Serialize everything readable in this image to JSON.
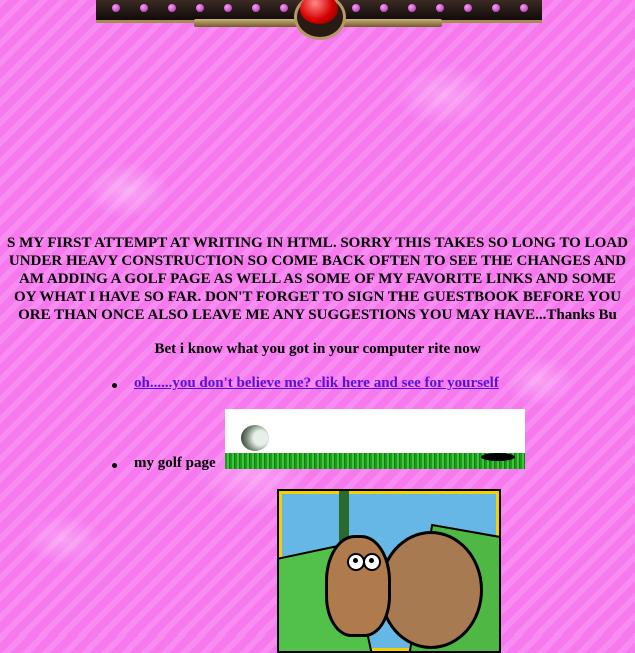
{
  "banner": {
    "colors": {
      "bar": "#120a08",
      "accent": "#b49a62",
      "ball": "#d60000"
    }
  },
  "intro": {
    "lines": [
      "S MY FIRST ATTEMPT AT WRITING IN HTML. SORRY THIS TAKES SO LONG TO LOAD",
      "UNDER HEAVY CONSTRUCTION SO COME BACK OFTEN TO SEE THE CHANGES AND",
      "AM ADDING A GOLF PAGE AS WELL AS SOME OF MY FAVORITE LINKS AND SOME",
      "OY WHAT I HAVE SO FAR. DON'T FORGET TO SIGN THE GUESTBOOK BEFORE YOU",
      "ORE THAN ONCE ALSO LEAVE ME ANY SUGGESTIONS YOU MAY HAVE...Thanks Bu"
    ]
  },
  "bet_text": "Bet i know what you got in your computer rite now",
  "links": {
    "computer_link": "oh......you don't believe me? clik here and see for yourself",
    "golf_label": "my golf page"
  },
  "images": {
    "golf_banner": "golf-ball-rolling-to-hole",
    "cartoon": "bug-pushing-boulder-cartoon"
  },
  "colors": {
    "background": "#f77ff0",
    "link": "#5a11d6"
  }
}
